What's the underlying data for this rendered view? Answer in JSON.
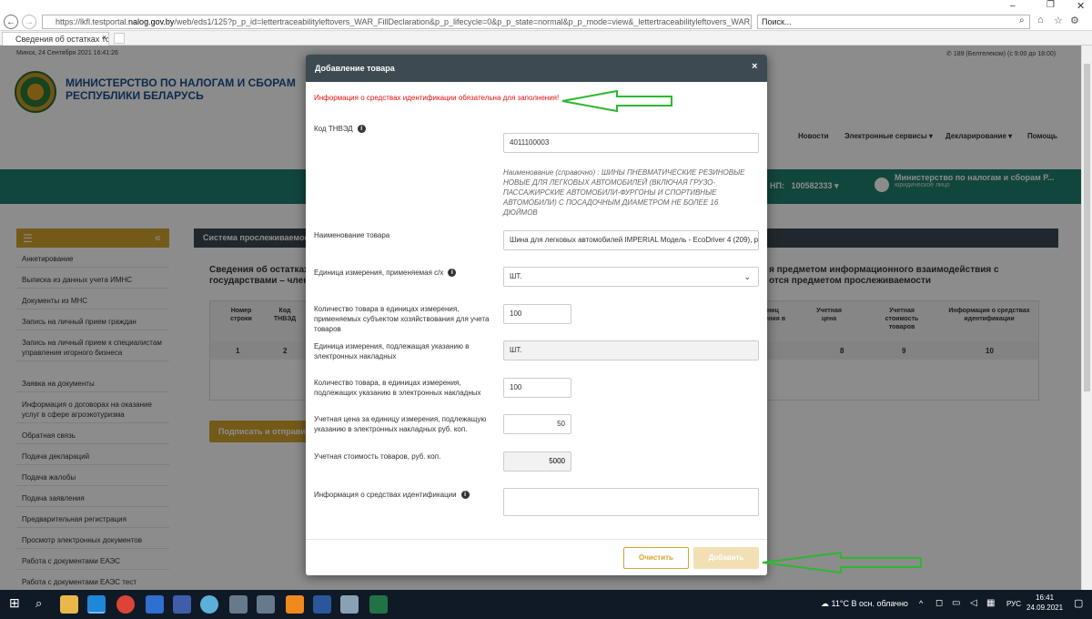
{
  "browser": {
    "url_prefix": "https://lkfl.testportal.",
    "url_host": "nalog.gov.by",
    "url_rest": "/web/eds1/125?p_p_id=lettertraceabilityleftovers_WAR_FillDeclaration&p_p_lifecycle=0&p_p_state=normal&p_p_mode=view&_lettertraceabilityleftovers_WAR_FillDeclaration_letterJspPage=",
    "search_placeholder": "Поиск...",
    "tab_title": "Сведения об остатках това..."
  },
  "header": {
    "datetime": "Минск, 24 Сентября 2021 16:41:26",
    "phone": "189 (Белтелеком) (с 9:00 до 18:00)",
    "ministry_line1": "МИНИСТЕРСТВО ПО НАЛОГАМ И СБОРАМ",
    "ministry_line2": "РЕСПУБЛИКИ БЕЛАРУСЬ",
    "nav": [
      "Новости",
      "Электронные сервисы",
      "Декларирование",
      "Помощь"
    ],
    "unp_label": "НП:",
    "unp_value": "100582333",
    "user_name": "Министерство по налогам и сборам Р...",
    "user_role": "юридическое лицо"
  },
  "sidebar": {
    "items": [
      "Анкетирование",
      "Выписка из данных учета ИМНС",
      "Документы из МНС",
      "Запись на личный прием граждан",
      "Запись на личный прием к специалистам управления игорного бизнеса",
      "Заявка на документы",
      "Информация о договорах на оказание услуг в сфере агроэкотуризма",
      "Обратная связь",
      "Подача деклараций",
      "Подача жалобы",
      "Подача заявления",
      "Предварительная регистрация",
      "Просмотр электронных документов",
      "Работа с документами ЕАЭС",
      "Работа с документами ЕАЭС тест"
    ]
  },
  "main": {
    "panel_title": "Система прослеживаемост",
    "title_left_1": "Сведения об остатках",
    "title_left_2": "государствами – член",
    "title_right_1": "я предметом информационного взаимодействия с",
    "title_right_2": "отся предметом прослеживаемости",
    "col_num": "Номер строки",
    "col_tnved": "Код ТНВЭД",
    "col_unit_partial": "диниц мерения в",
    "col_price": "Учетная цена",
    "col_cost": "Учетная стоимость товаров",
    "col_ident": "Информация о средствах идентификации",
    "idx": [
      "1",
      "2",
      "8",
      "9",
      "10"
    ],
    "sign_button": "Подписать и отправит"
  },
  "modal": {
    "title": "Добавление товара",
    "close": "×",
    "warning": "Информация о средствах идентификации обязательна для заполнения!",
    "tnved_label": "Код ТНВЭД",
    "tnved_value": "4011100003",
    "hint": "Наименование (справочно) :   ШИНЫ ПНЕВМАТИЧЕСКИЕ РЕЗИНОВЫЕ НОВЫЕ ДЛЯ ЛЕГКОВЫХ АВТОМОБИЛЕЙ (ВКЛЮЧАЯ ГРУЗО-ПАССАЖИРСКИЕ АВТОМОБИЛИ-ФУРГОНЫ И СПОРТИВНЫЕ АВТОМОБИЛИ) С ПОСАДОЧНЫМ ДИАМЕТРОМ НЕ БОЛЕЕ 16 ДЮЙМОВ",
    "name_label": "Наименование товара",
    "name_value": "Шина для легковых автомобилей IMPERIAL  Модель - EcoDriver 4 (209), р:",
    "unit_label": "Единица измерения, применяемая с/х",
    "unit_value": "ШТ.",
    "qty_label": "Количество товара в единицах измерения, применяемых субъектом хозяйствования для учета товаров",
    "qty_value": "100",
    "unit_doc_label": "Единица измерения, подлежащая указанию в электронных накладных",
    "unit_doc_value": "ШТ.",
    "qty_doc_label": "Количество товара, в единицах измерения, подлежащих указанию в электронных накладных",
    "qty_doc_value": "100",
    "price_label": "Учетная цена за единицу измерения, подлежащую указанию в электронных накладных руб. коп.",
    "price_value": "50",
    "cost_label": "Учетная стоимость товаров, руб. коп.",
    "cost_value": "5000",
    "ident_label": "Информация о средствах идентификации",
    "ident_value": "",
    "clear_button": "Очистить",
    "add_button": "Добавить"
  },
  "taskbar": {
    "weather": "11°C  В осн. облачно",
    "lang": "РУС",
    "time": "16:41",
    "date": "24.09.2021"
  },
  "colors": {
    "teal": "#1f8070",
    "gold": "#d4a52f",
    "dark_header": "#3d4a52",
    "warning_red": "#e01010",
    "annotation_arrow": "#2db82d"
  }
}
